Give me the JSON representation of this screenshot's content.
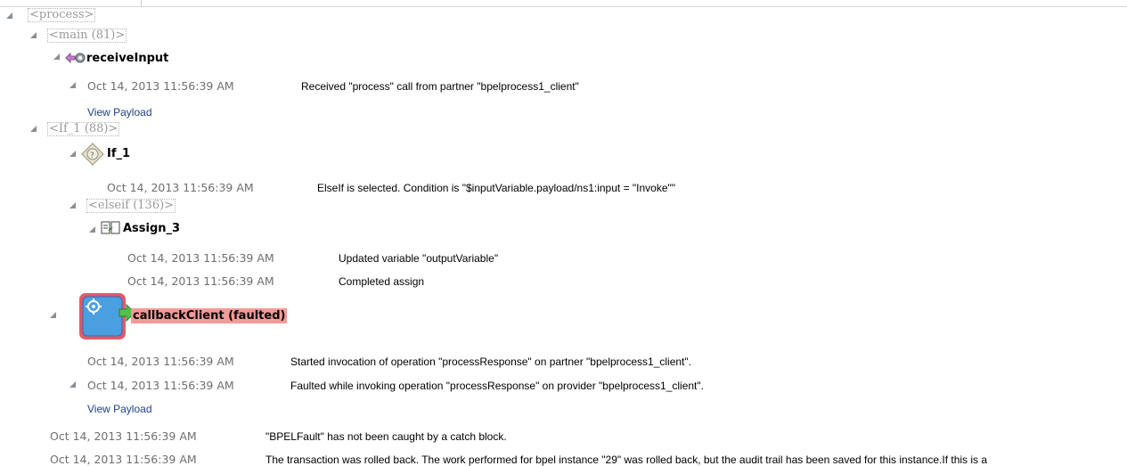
{
  "tree": {
    "process": "<process>",
    "main": "<main (81)>",
    "receive": {
      "name": "receiveInput",
      "ts": "Oct 14, 2013 11:56:39 AM",
      "msg": "Received \"process\" call from partner \"bpelprocess1_client\"",
      "link": "View Payload"
    },
    "if_scope": "<If_1 (88)>",
    "if_act": {
      "name": "If_1",
      "ts": "Oct 14, 2013 11:56:39 AM",
      "msg": "ElseIf is selected. Condition is \"$inputVariable.payload/ns1:input = \"Invoke\"\""
    },
    "elseif_scope": "<elseif (136)>",
    "assign": {
      "name": "Assign_3",
      "rows": [
        {
          "ts": "Oct 14, 2013 11:56:39 AM",
          "msg": "Updated variable \"outputVariable\""
        },
        {
          "ts": "Oct 14, 2013 11:56:39 AM",
          "msg": "Completed assign"
        }
      ]
    },
    "callback": {
      "name": "callbackClient (faulted)",
      "rows": [
        {
          "ts": "Oct 14, 2013 11:56:39 AM",
          "msg": "Started invocation of operation \"processResponse\" on partner \"bpelprocess1_client\"."
        },
        {
          "ts": "Oct 14, 2013 11:56:39 AM",
          "msg": "Faulted while invoking operation \"processResponse\" on provider \"bpelprocess1_client\"."
        }
      ],
      "link": "View Payload"
    },
    "bottom": [
      {
        "ts": "Oct 14, 2013 11:56:39 AM",
        "msg": "\"BPELFault\" has not been caught by a catch block."
      },
      {
        "ts": "Oct 14, 2013 11:56:39 AM",
        "msg": "The transaction was rolled back. The work performed for bpel instance \"29\" was rolled back, but the audit trail has been saved for this instance.If this is a"
      }
    ]
  },
  "colors": {
    "fault_highlight": "#f49a98",
    "link": "#1e3f8a",
    "icon_blue": "#4a9fe0",
    "icon_border": "#e05a6a"
  }
}
